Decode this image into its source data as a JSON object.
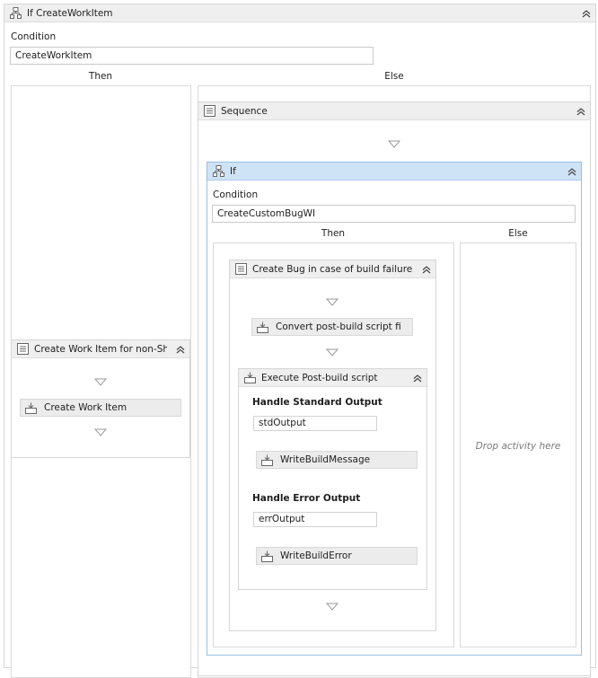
{
  "outer_if": {
    "title": "If CreateWorkItem",
    "condition_label": "Condition",
    "condition_value": "CreateWorkItem",
    "then_label": "Then",
    "else_label": "Else"
  },
  "then_branch": {
    "seq_title": "Create Work Item for non-Shelv",
    "activity": "Create Work Item"
  },
  "else_branch": {
    "seq_title": "Sequence",
    "inner_if": {
      "title": "If",
      "condition_label": "Condition",
      "condition_value": "CreateCustomBugWI",
      "then_label": "Then",
      "else_label": "Else",
      "else_drop": "Drop activity here",
      "then_seq": {
        "title": "Create Bug in case of build failure",
        "convert_activity": "Convert post-build script fi",
        "execute": {
          "title": "Execute Post-build script",
          "std_label": "Handle Standard Output",
          "std_value": "stdOutput",
          "std_activity": "WriteBuildMessage",
          "err_label": "Handle Error Output",
          "err_value": "errOutput",
          "err_activity": "WriteBuildError"
        }
      }
    }
  },
  "icons": {
    "if": "if-icon",
    "sequence": "sequence-icon",
    "activity": "activity-icon",
    "collapse": "collapse-chevron-icon",
    "arrow": "drop-arrow-icon"
  }
}
